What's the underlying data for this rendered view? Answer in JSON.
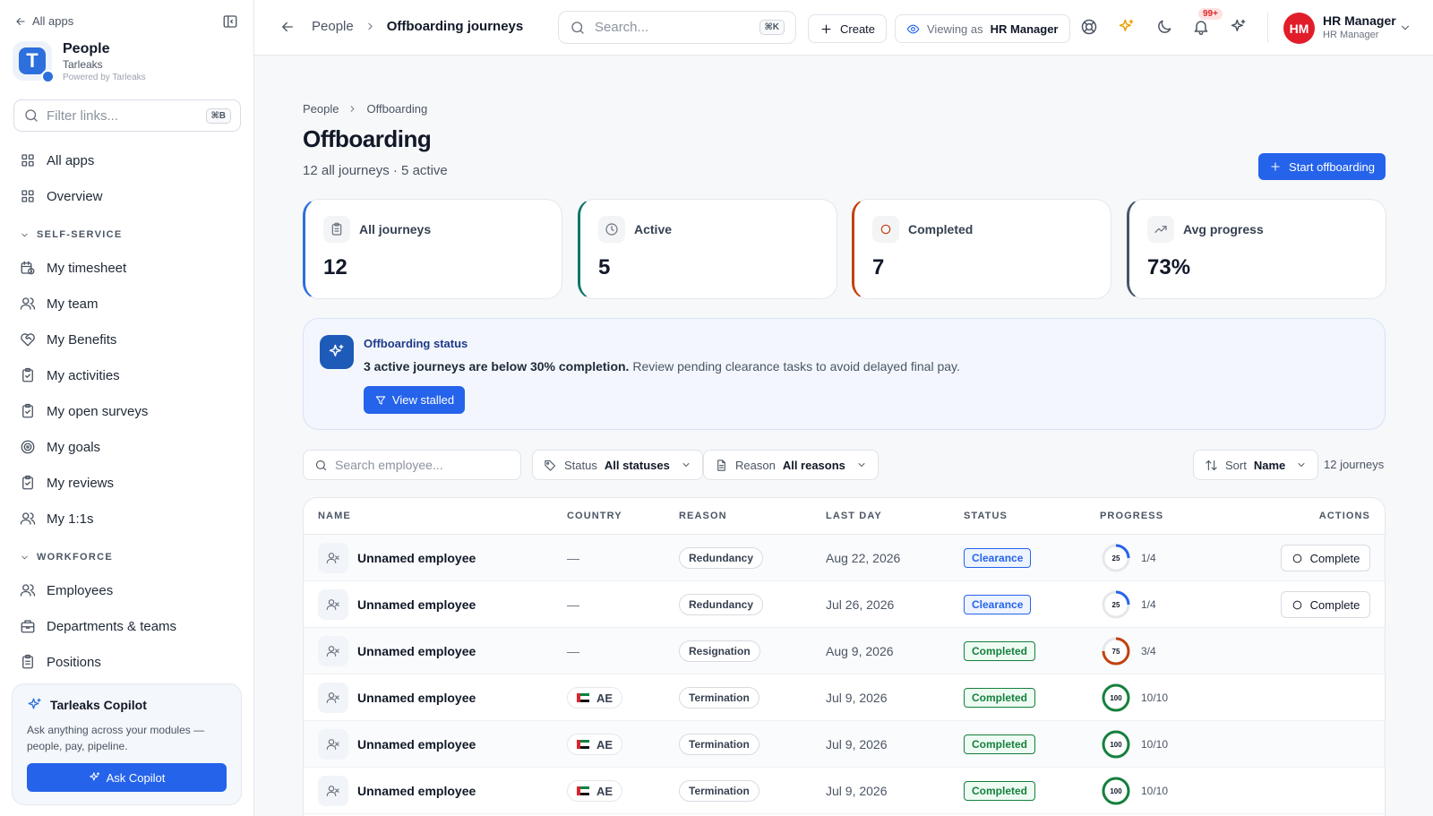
{
  "colors": {
    "accent": "#2563eb",
    "stat_all": "#2d6fdc",
    "stat_active": "#0f766e",
    "stat_completed": "#c2410c",
    "stat_avg": "#475569",
    "clearance": "#2563eb",
    "completed": "#15803d",
    "avatar": "#e11d2a"
  },
  "sidebar": {
    "back_label": "All apps",
    "app_name": "People",
    "org": "Tarleaks",
    "powered": "Powered by Tarleaks",
    "logo_letter": "T",
    "filter_placeholder": "Filter links...",
    "filter_kbd": "⌘B",
    "top_items": [
      {
        "label": "All apps",
        "icon": "grid-icon"
      },
      {
        "label": "Overview",
        "icon": "grid-icon"
      }
    ],
    "sections": [
      {
        "title": "SELF-SERVICE",
        "items": [
          {
            "label": "My timesheet",
            "icon": "calendar-clock-icon"
          },
          {
            "label": "My team",
            "icon": "users-icon"
          },
          {
            "label": "My Benefits",
            "icon": "heart-handshake-icon"
          },
          {
            "label": "My activities",
            "icon": "clipboard-check-icon"
          },
          {
            "label": "My open surveys",
            "icon": "clipboard-check-icon"
          },
          {
            "label": "My goals",
            "icon": "target-icon"
          },
          {
            "label": "My reviews",
            "icon": "clipboard-check-icon"
          },
          {
            "label": "My 1:1s",
            "icon": "users-icon"
          }
        ]
      },
      {
        "title": "WORKFORCE",
        "items": [
          {
            "label": "Employees",
            "icon": "users-icon"
          },
          {
            "label": "Departments & teams",
            "icon": "building-icon"
          },
          {
            "label": "Positions",
            "icon": "clipboard-list-icon"
          }
        ]
      }
    ],
    "copilot": {
      "title": "Tarleaks Copilot",
      "desc": "Ask anything across your modules — people, pay, pipeline.",
      "button": "Ask Copilot"
    }
  },
  "topbar": {
    "crumb_parent": "People",
    "crumb_current": "Offboarding journeys",
    "search_placeholder": "Search...",
    "search_kbd": "⌘K",
    "create_label": "Create",
    "viewing_prefix": "Viewing as",
    "viewing_role": "HR Manager",
    "notif_badge": "99+",
    "user_initials": "HM",
    "user_name": "HR Manager",
    "user_role": "HR Manager"
  },
  "page": {
    "crumb_parent": "People",
    "crumb_current": "Offboarding",
    "title": "Offboarding",
    "subtitle": "12 all journeys · 5 active",
    "primary_button": "Start offboarding"
  },
  "stats": [
    {
      "label": "All journeys",
      "value": "12",
      "icon": "clipboard-icon"
    },
    {
      "label": "Active",
      "value": "5",
      "icon": "clock-icon"
    },
    {
      "label": "Completed",
      "value": "7",
      "icon": "circle-icon"
    },
    {
      "label": "Avg progress",
      "value": "73%",
      "icon": "trending-up-icon"
    }
  ],
  "alert": {
    "title": "Offboarding status",
    "bold": "3 active journeys are below 30% completion.",
    "rest": " Review pending clearance tasks to avoid delayed final pay.",
    "button": "View stalled"
  },
  "filters": {
    "search_placeholder": "Search employee...",
    "status_label": "Status",
    "status_value": "All statuses",
    "reason_label": "Reason",
    "reason_value": "All reasons",
    "sort_label": "Sort",
    "sort_value": "Name",
    "count": "12 journeys"
  },
  "table": {
    "headers": [
      "NAME",
      "COUNTRY",
      "REASON",
      "LAST DAY",
      "STATUS",
      "PROGRESS",
      "ACTIONS"
    ],
    "rows": [
      {
        "name": "Unnamed employee",
        "country": "",
        "reason": "Redundancy",
        "last_day": "Aug 22, 2026",
        "status": "Clearance",
        "progress": 25,
        "progress_text": "1/4",
        "action": "Complete"
      },
      {
        "name": "Unnamed employee",
        "country": "",
        "reason": "Redundancy",
        "last_day": "Jul 26, 2026",
        "status": "Clearance",
        "progress": 25,
        "progress_text": "1/4",
        "action": "Complete"
      },
      {
        "name": "Unnamed employee",
        "country": "",
        "reason": "Resignation",
        "last_day": "Aug 9, 2026",
        "status": "Completed",
        "progress": 75,
        "progress_text": "3/4",
        "action": ""
      },
      {
        "name": "Unnamed employee",
        "country": "AE",
        "reason": "Termination",
        "last_day": "Jul 9, 2026",
        "status": "Completed",
        "progress": 100,
        "progress_text": "10/10",
        "action": ""
      },
      {
        "name": "Unnamed employee",
        "country": "AE",
        "reason": "Termination",
        "last_day": "Jul 9, 2026",
        "status": "Completed",
        "progress": 100,
        "progress_text": "10/10",
        "action": ""
      },
      {
        "name": "Unnamed employee",
        "country": "AE",
        "reason": "Termination",
        "last_day": "Jul 9, 2026",
        "status": "Completed",
        "progress": 100,
        "progress_text": "10/10",
        "action": ""
      }
    ],
    "empty_country": "—"
  }
}
